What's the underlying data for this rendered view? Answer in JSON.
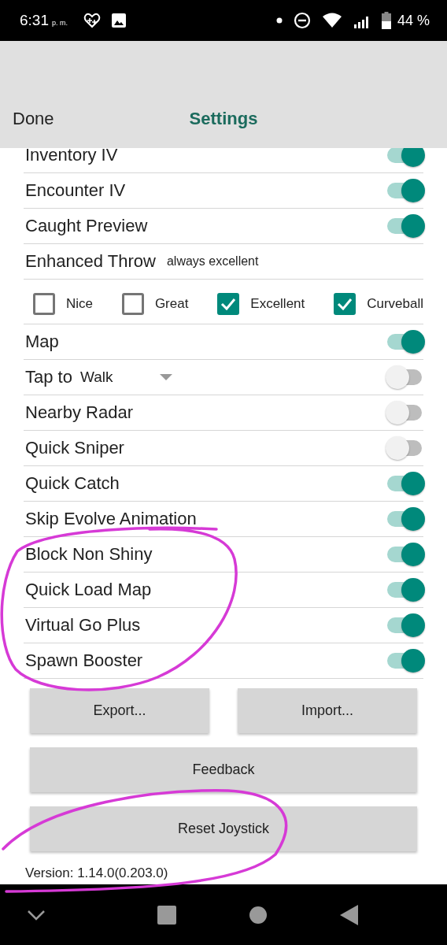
{
  "status_bar": {
    "time": "6:31",
    "time_suffix": "p. m.",
    "battery": "44 %"
  },
  "header": {
    "left_button": "Done",
    "title": "Settings"
  },
  "settings": [
    {
      "kind": "toggle",
      "label": "Inventory IV",
      "on": true
    },
    {
      "kind": "toggle",
      "label": "Encounter IV",
      "on": true
    },
    {
      "kind": "toggle",
      "label": "Caught Preview",
      "on": true
    },
    {
      "kind": "note",
      "label": "Enhanced Throw",
      "value": "always excellent"
    },
    {
      "kind": "checkboxes",
      "options": [
        {
          "label": "Nice",
          "checked": false
        },
        {
          "label": "Great",
          "checked": false
        },
        {
          "label": "Excellent",
          "checked": true
        },
        {
          "label": "Curveball",
          "checked": true
        }
      ]
    },
    {
      "kind": "toggle",
      "label": "Map",
      "on": true
    },
    {
      "kind": "dropdown",
      "label": "Tap to",
      "value": "Walk",
      "on": false
    },
    {
      "kind": "toggle",
      "label": "Nearby Radar",
      "on": false
    },
    {
      "kind": "toggle",
      "label": "Quick Sniper",
      "on": false
    },
    {
      "kind": "toggle",
      "label": "Quick Catch",
      "on": true
    },
    {
      "kind": "toggle",
      "label": "Skip Evolve Animation",
      "on": true
    },
    {
      "kind": "toggle",
      "label": "Block Non Shiny",
      "on": true
    },
    {
      "kind": "toggle",
      "label": "Quick Load Map",
      "on": true
    },
    {
      "kind": "toggle",
      "label": "Virtual Go Plus",
      "on": true
    },
    {
      "kind": "toggle",
      "label": "Spawn Booster",
      "on": true
    }
  ],
  "button_rows": [
    [
      "Export...",
      "Import..."
    ],
    [
      "Feedback"
    ],
    [
      "Reset Joystick"
    ]
  ],
  "version": "Version: 1.14.0(0.203.0)",
  "annotations": [
    {
      "kind": "loop"
    },
    {
      "kind": "sweep"
    }
  ]
}
